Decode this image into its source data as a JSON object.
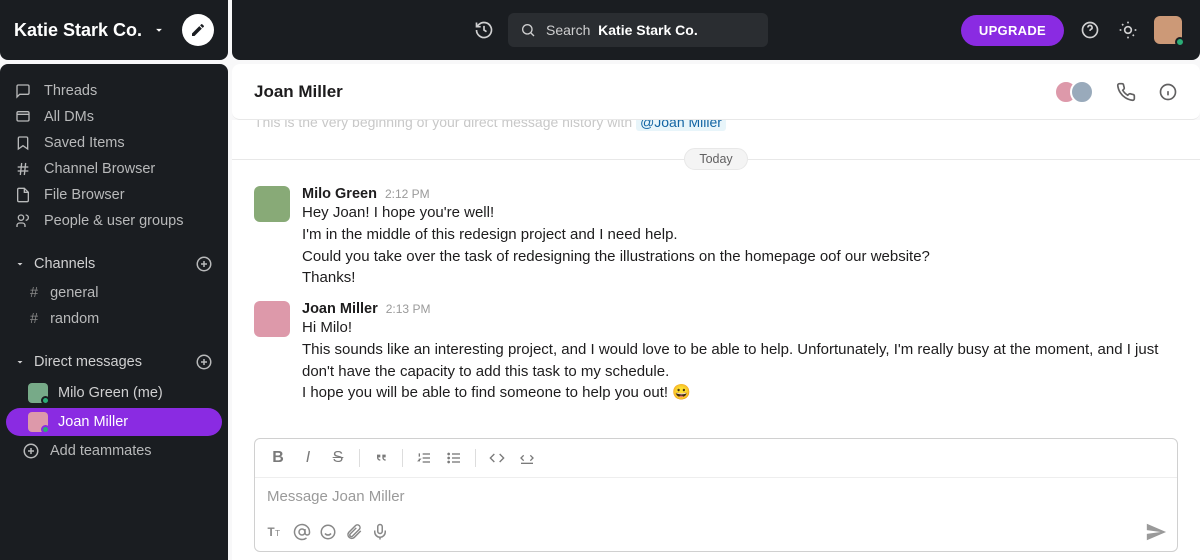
{
  "workspace": {
    "name": "Katie Stark Co."
  },
  "sidebar": {
    "nav": [
      {
        "label": "Threads"
      },
      {
        "label": "All DMs"
      },
      {
        "label": "Saved Items"
      },
      {
        "label": "Channel Browser"
      },
      {
        "label": "File Browser"
      },
      {
        "label": "People & user groups"
      }
    ],
    "channels_header": "Channels",
    "channels": [
      {
        "name": "general"
      },
      {
        "name": "random"
      }
    ],
    "dms_header": "Direct messages",
    "dms": [
      {
        "name": "Milo Green (me)",
        "active": false
      },
      {
        "name": "Joan Miller",
        "active": true
      }
    ],
    "add_teammates": "Add teammates"
  },
  "topbar": {
    "search_prefix": "Search",
    "search_bold": "Katie Stark Co.",
    "upgrade": "UPGRADE"
  },
  "conversation": {
    "title": "Joan Miller",
    "intro_prefix": "This is the very beginning of your direct message history with ",
    "intro_mention": "@Joan Miller",
    "divider": "Today",
    "messages": [
      {
        "author": "Milo Green",
        "time": "2:12 PM",
        "lines": [
          "Hey Joan! I hope you're well!",
          "I'm in the middle of this redesign project and I need help.",
          "Could you take over the task of redesigning the illustrations on the homepage oof our website?",
          "Thanks!"
        ]
      },
      {
        "author": "Joan Miller",
        "time": "2:13 PM",
        "lines": [
          "Hi Milo!",
          "This sounds like an interesting project, and I would love to be able to help. Unfortunately, I'm really busy at the moment, and I just don't have the capacity to add this task to my schedule.",
          "I hope you will be able to find someone to help you out! 😀"
        ]
      }
    ]
  },
  "composer": {
    "placeholder": "Message Joan Miller"
  },
  "colors": {
    "accent": "#8a2be2",
    "online": "#2bac76"
  }
}
